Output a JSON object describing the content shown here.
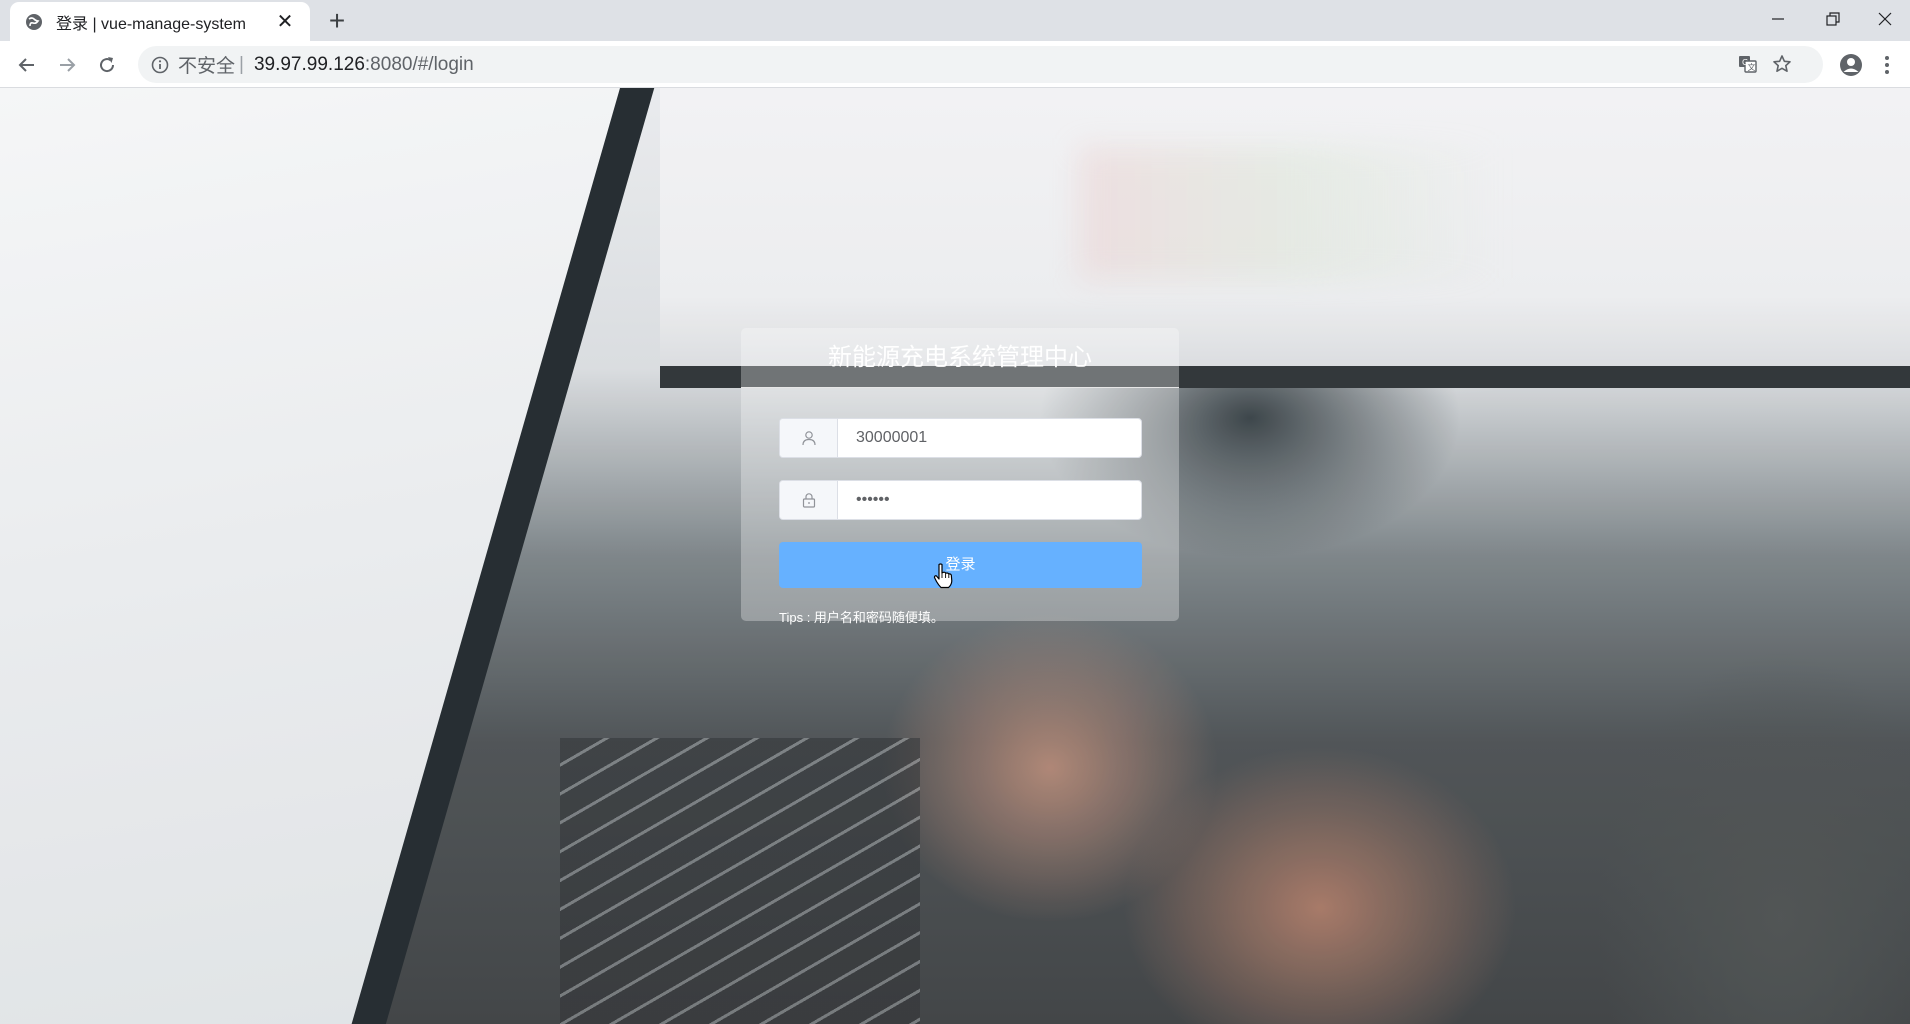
{
  "browser": {
    "tab_title": "登录 | vue-manage-system",
    "tab_close": "✕",
    "new_tab": "+",
    "security_label": "不安全",
    "separator": "|",
    "url_host": "39.97.99.126",
    "url_path": ":8080/#/login"
  },
  "login": {
    "title": "新能源充电系统管理中心",
    "username_value": "30000001",
    "password_value": "••••••",
    "submit_label": "登录",
    "tips": "Tips : 用户名和密码随便填。"
  },
  "colors": {
    "primary_button": "#66b1ff",
    "tab_strip": "#dee1e6",
    "omnibox": "#f1f3f4"
  },
  "icons": {
    "tab_favicon": "globe-icon",
    "back": "arrow-left-icon",
    "forward": "arrow-right-icon",
    "reload": "reload-icon",
    "site_info": "info-icon",
    "translate": "translate-icon",
    "bookmark": "star-icon",
    "profile": "account-icon",
    "menu": "more-vert-icon",
    "username": "user-icon",
    "password": "lock-icon"
  }
}
